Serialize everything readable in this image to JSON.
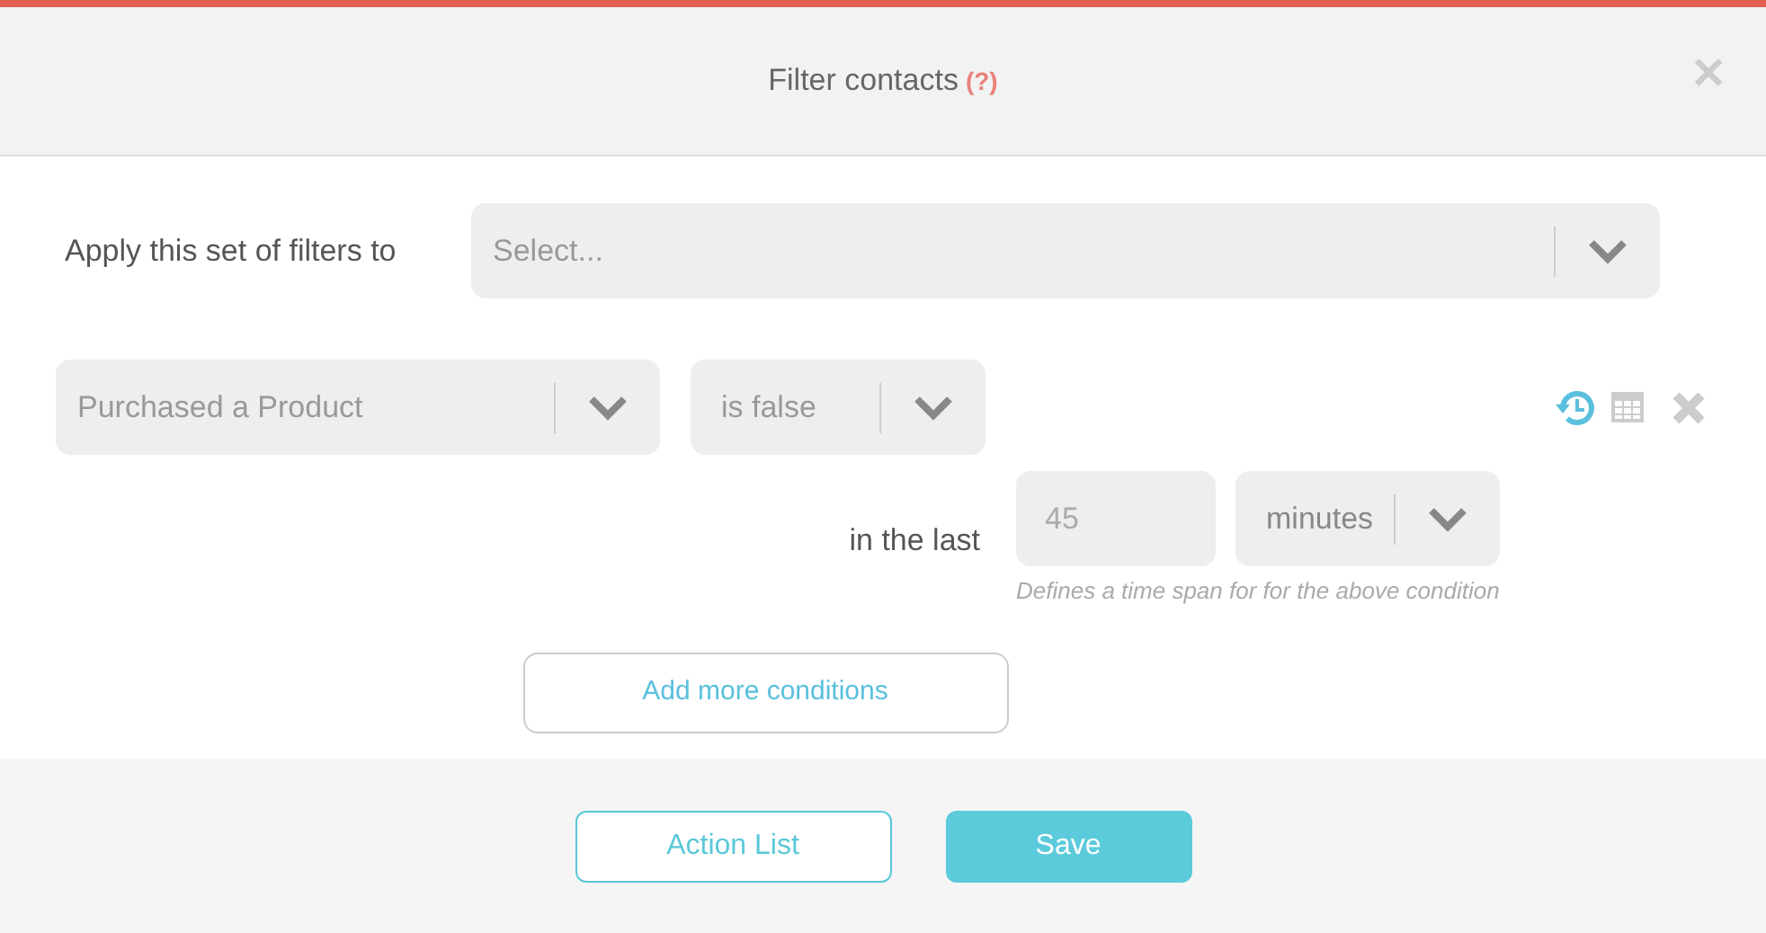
{
  "dialog": {
    "title": "Filter contacts",
    "help": "(?)",
    "close": "✕"
  },
  "target": {
    "label": "Apply this set of filters to",
    "placeholder": "Select..."
  },
  "condition": {
    "field": "Purchased a Product",
    "operator": "is false",
    "tools": [
      {
        "kind": "history",
        "active": true
      },
      {
        "kind": "calendar",
        "active": false
      },
      {
        "kind": "remove",
        "active": false
      }
    ],
    "timespan": {
      "label": "in the last",
      "amount_placeholder": "45",
      "unit": "minutes",
      "hint": "Defines a time span for for the above condition"
    }
  },
  "add_button": "Add more conditions",
  "footer_buttons": [
    {
      "label": "Action List",
      "kind": "outline"
    },
    {
      "label": "Save",
      "kind": "primary"
    }
  ]
}
